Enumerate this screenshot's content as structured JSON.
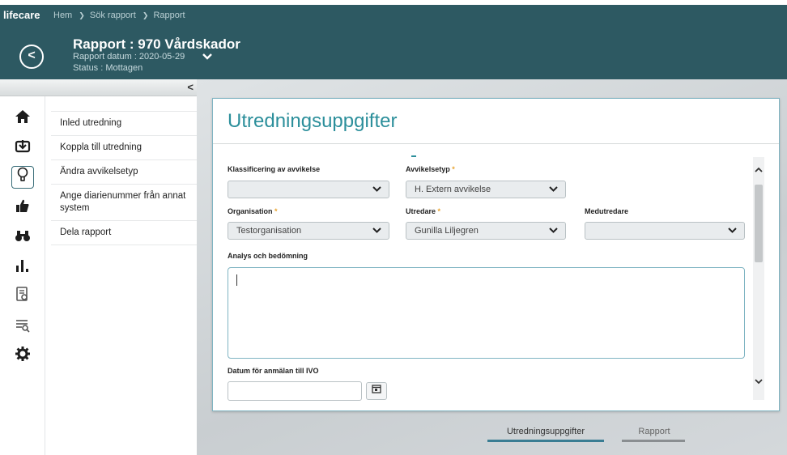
{
  "topbar": {
    "brand": "lifecare",
    "breadcrumbs": [
      "Hem",
      "Sök rapport",
      "Rapport"
    ],
    "separator": "❯"
  },
  "header": {
    "back_icon": "chevron-left-icon",
    "title": "Rapport : 970 Vårdskador",
    "date_line": "Rapport datum : 2020-05-29",
    "status_line": "Status : Mottagen",
    "expand_icon": "chevron-down-icon"
  },
  "sidebar": {
    "collapse_glyph": "<",
    "rail_icons": [
      "home-icon",
      "inbox-icon",
      "lightbulb-icon",
      "thumbs-up-icon",
      "binoculars-icon",
      "bar-chart-icon",
      "document-search-icon",
      "list-search-icon",
      "gear-icon"
    ],
    "rail_glyphs": [
      "⌂",
      "⬇",
      "♀",
      "👍",
      "∞",
      "ıl.",
      "▤",
      "≡",
      "✹"
    ],
    "menu": [
      {
        "label": "Inled utredning"
      },
      {
        "label": "Koppla till utredning"
      },
      {
        "label": "Ändra avvikelsetyp"
      },
      {
        "label": "Ange diarienummer från annat system"
      },
      {
        "label": "Dela rapport"
      }
    ]
  },
  "form": {
    "title": "Utredningsuppgifter",
    "required_mark": "*",
    "klassificering": {
      "label": "Klassificering av avvikelse",
      "value": ""
    },
    "avvikelsetyp": {
      "label": "Avvikelsetyp",
      "value": "H. Extern avvikelse"
    },
    "organisation": {
      "label": "Organisation",
      "value": "Testorganisation"
    },
    "utredare": {
      "label": "Utredare",
      "value": "Gunilla Liljegren"
    },
    "medutredare": {
      "label": "Medutredare",
      "value": ""
    },
    "analys": {
      "label": "Analys och bedömning",
      "value": ""
    },
    "datum_ivo": {
      "label": "Datum för anmälan till IVO",
      "value": ""
    },
    "calendar_icon": "calendar-icon",
    "calendar_glyph": "▦",
    "chevron_glyph": "⌄"
  },
  "bottom_tabs": {
    "tab1": "Utredningsuppgifter",
    "tab2": "Rapport"
  },
  "colors": {
    "header_bg": "#2d5962",
    "accent": "#2c8f9b",
    "required": "#e8a431"
  }
}
